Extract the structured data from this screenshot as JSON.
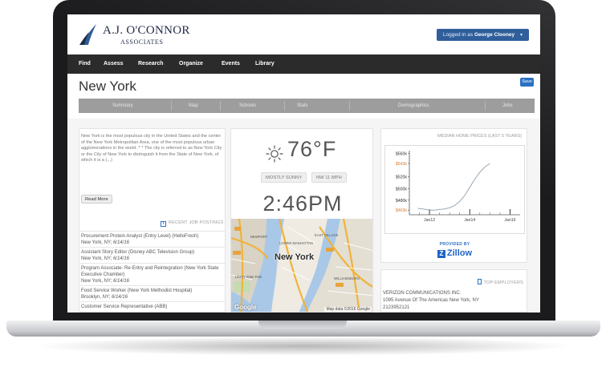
{
  "header": {
    "logo_name": "A.J. O'CONNOR",
    "logo_sub": "ASSOCIATES",
    "login_prefix": "Logged in as",
    "login_user": "George Clooney"
  },
  "nav": [
    "Find",
    "Assess",
    "Research",
    "Organize",
    "Events",
    "Library"
  ],
  "page": {
    "title": "New York",
    "save_label": "Save"
  },
  "tabs": [
    "Summary",
    "Map",
    "Schools",
    "Stats",
    "Demographics",
    "Jobs"
  ],
  "summary": {
    "description": "New York is the most populous city in the United States and the center of the New York Metropolitan Area, one of the most populous urban agglomerations in the world. * * The city is referred to as New York City or the City of New York to distinguish it from the State of New York, of which it is a (...)",
    "read_more": "Read More"
  },
  "jobs": {
    "heading": "RECENT JOB POSTINGS",
    "items": [
      {
        "title": "Procurement Protein Analyst (Entry Level) (HelloFresh)",
        "location": "New York, NY;",
        "date": "6/14/16"
      },
      {
        "title": "Assistant Story Editor (Disney ABC Television Group)",
        "location": "New York, NY;",
        "date": "6/14/16"
      },
      {
        "title": "Program Associate- Re-Entry and Reintegration (New York State Executive Chamber)",
        "location": "New York, NY;",
        "date": "6/14/16"
      },
      {
        "title": "Food Service Worker (New York Methodist Hospital)",
        "location": "Brooklyn, NY;",
        "date": "6/14/16"
      },
      {
        "title": "Customer Service Representative (ABB)",
        "location": "",
        "date": ""
      }
    ]
  },
  "weather": {
    "temperature": "76°F",
    "condition": "MOSTLY SUNNY",
    "wind": "NW 11 MPH",
    "time": "2:46PM",
    "icon": "sun-icon"
  },
  "map": {
    "city_label": "New York",
    "google": "Google",
    "credit": "Map data ©2016 Google",
    "labels": [
      "Liberty State Park",
      "WILLIAMSBURG",
      "LOWER MANHATTAN",
      "EAST VILLAGE",
      "NEWPORT"
    ]
  },
  "home_prices": {
    "title": "MEDIAN HOME PRICES (LAST 5 YEARS)",
    "provided_by": "PROVIDED BY",
    "brand": "Zillow"
  },
  "chart_data": {
    "type": "line",
    "title": "MEDIAN HOME PRICES (LAST 5 YEARS)",
    "xlabel": "",
    "ylabel": "",
    "x_ticks": [
      "Jan12",
      "Jan14",
      "Jan16"
    ],
    "y_ticks": [
      "$463k",
      "$480k",
      "$500k",
      "$520k",
      "$543k",
      "$560k"
    ],
    "highlighted_ticks": [
      "$543k",
      "$463k"
    ],
    "ylim": [
      455,
      565
    ],
    "series": [
      {
        "x": [
          "2011-06",
          "2011-09",
          "2012-01",
          "2012-04",
          "2012-07",
          "2012-10",
          "2013-01",
          "2013-04",
          "2013-07",
          "2013-10",
          "2014-01",
          "2014-04",
          "2014-07",
          "2014-10",
          "2015-01"
        ],
        "values": [
          466,
          465,
          463,
          463,
          464,
          465,
          467,
          471,
          478,
          488,
          502,
          516,
          528,
          537,
          543
        ]
      }
    ],
    "grid": false,
    "colors": {
      "line": "#9aa7b4",
      "highlight_tick": "#e07a2f",
      "tick": "#333333"
    }
  },
  "employers": {
    "heading": "TOP EMPLOYERS",
    "name": "VERIZON COMMUNICATIONS INC.",
    "address": "1095 Avenue Of The Americas New York, NY",
    "phone": "2123952121"
  },
  "colors": {
    "brand_blue": "#2f5e9b",
    "navbar": "#2b2b2b",
    "tabbar": "#9d9d9d",
    "save_blue": "#2a70c4"
  }
}
